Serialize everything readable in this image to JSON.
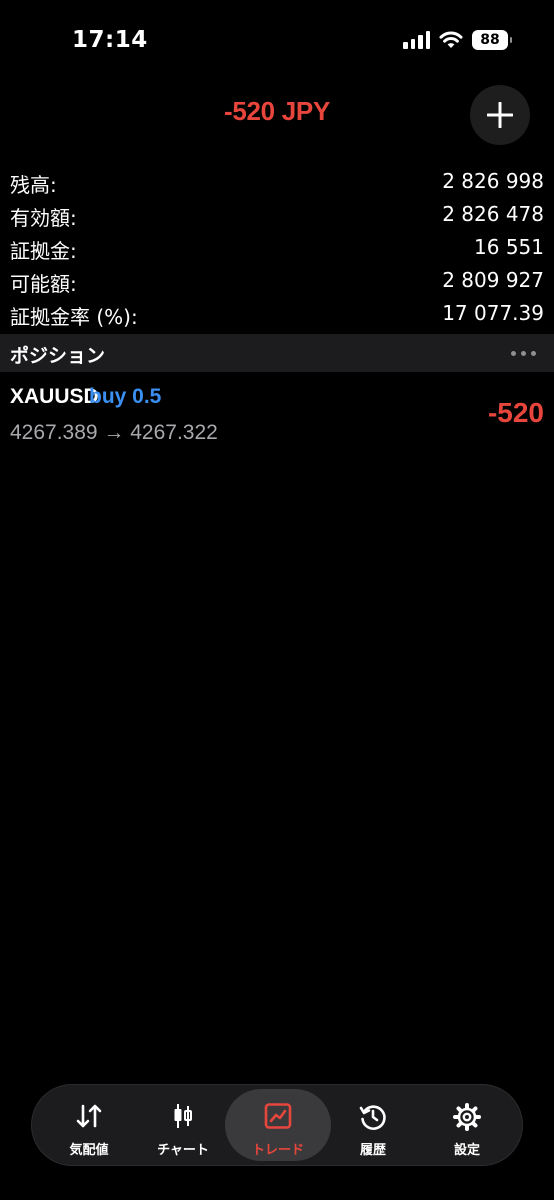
{
  "status_bar": {
    "time": "17:14",
    "battery": "88"
  },
  "header": {
    "pl": "-520 JPY",
    "add_icon": "plus-icon"
  },
  "account": [
    {
      "label": "残高:",
      "value": "2 826 998"
    },
    {
      "label": "有効額:",
      "value": "2 826 478"
    },
    {
      "label": "証拠金:",
      "value": "16 551"
    },
    {
      "label": "可能額:",
      "value": "2 809 927"
    },
    {
      "label": "証拠金率 (%):",
      "value": "17 077.39"
    }
  ],
  "positions_section": {
    "title": "ポジション",
    "more_icon": "ellipsis-icon"
  },
  "positions": [
    {
      "symbol": "XAUUSD",
      "side": "buy 0.5",
      "prices": "4267.389 → 4267.322",
      "profit": "-520"
    }
  ],
  "tabs": [
    {
      "label": "気配値",
      "icon": "quotes-arrows-icon",
      "active": false
    },
    {
      "label": "チャート",
      "icon": "candlestick-icon",
      "active": false
    },
    {
      "label": "トレード",
      "icon": "trade-chart-icon",
      "active": true
    },
    {
      "label": "履歴",
      "icon": "history-clock-icon",
      "active": false
    },
    {
      "label": "設定",
      "icon": "gear-icon",
      "active": false
    }
  ],
  "colors": {
    "loss": "#e8463c",
    "buy": "#3b8ff2",
    "background": "#000000"
  }
}
